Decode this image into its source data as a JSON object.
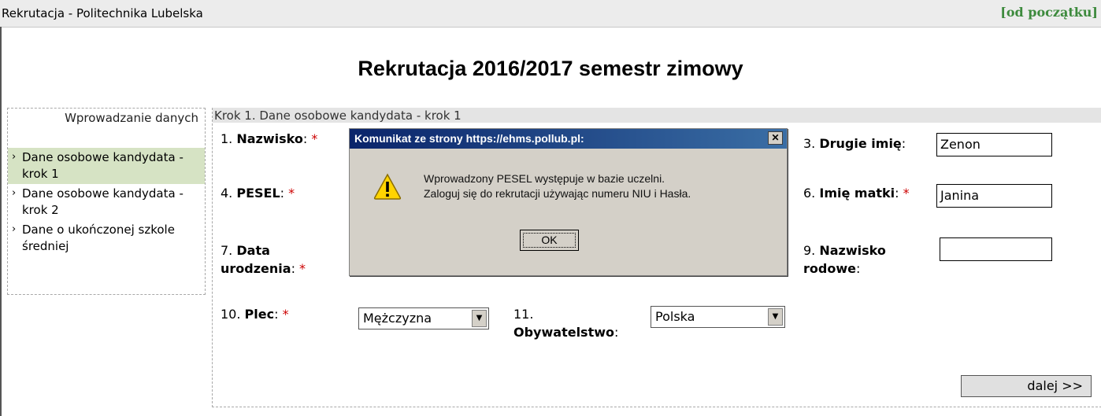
{
  "topbar": {
    "title": "Rekrutacja - Politechnika Lubelska",
    "restart_link": "[od początku]"
  },
  "heading": "Rekrutacja 2016/2017 semestr zimowy",
  "menu": {
    "header": "Wprowadzanie danych",
    "items": [
      {
        "label": "Dane osobowe kandydata - krok 1",
        "active": true
      },
      {
        "label": "Dane osobowe kandydata - krok 2",
        "active": false
      },
      {
        "label": "Dane o ukończonej szkole średniej",
        "active": false
      }
    ]
  },
  "panel": {
    "header": "Krok 1. Dane osobowe kandydata - krok 1"
  },
  "fields": {
    "f1": {
      "num": "1.",
      "label": "Nazwisko",
      "req": "*"
    },
    "f3": {
      "num": "3.",
      "label": "Drugie imię",
      "value": "Zenon"
    },
    "f4": {
      "num": "4.",
      "label": "PESEL",
      "req": "*"
    },
    "f6": {
      "num": "6.",
      "label": "Imię matki",
      "req": "*",
      "value": "Janina"
    },
    "f7": {
      "num": "7.",
      "label1": "Data",
      "label2": "urodzenia",
      "req": "*"
    },
    "f9": {
      "num": "9.",
      "label1": "Nazwisko",
      "label2": "rodowe",
      "value": ""
    },
    "f10": {
      "num": "10.",
      "label": "Plec",
      "req": "*",
      "value": "Mężczyzna"
    },
    "f11": {
      "num": "11.",
      "label": "Obywatelstwo",
      "value": "Polska"
    }
  },
  "next_button": "dalej >>",
  "dialog": {
    "title": "Komunikat ze strony https://ehms.pollub.pl:",
    "line1": "Wprowadzony PESEL występuje w bazie uczelni.",
    "line2": "Zaloguj się do rekrutacji używając numeru NIU i Hasła.",
    "ok": "OK",
    "close": "✕"
  },
  "icons": {
    "chevron": "›",
    "warning": "warning-icon",
    "dropdown": "▼"
  }
}
